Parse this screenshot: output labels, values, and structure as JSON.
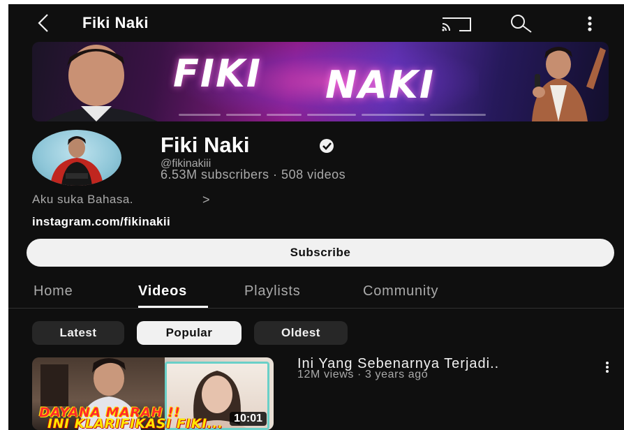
{
  "app_bar": {
    "title": "Fiki Naki",
    "icons": [
      "back-arrow-icon",
      "cast-icon",
      "search-icon",
      "more-vert-icon"
    ]
  },
  "banner": {
    "word_1": "FIKI",
    "word_2": "NAKI"
  },
  "channel": {
    "name": "Fiki Naki",
    "verified": true,
    "handle": "@fikinakiii",
    "stats": "6.53M subscribers · 508 videos",
    "description": "Aku suka Bahasa.",
    "description_more": ">",
    "link": "instagram.com/fikinakii"
  },
  "subscribe": {
    "label": "Subscribe"
  },
  "tabs": [
    {
      "label": "Home",
      "active": false
    },
    {
      "label": "Videos",
      "active": true
    },
    {
      "label": "Playlists",
      "active": false
    },
    {
      "label": "Community",
      "active": false
    }
  ],
  "sort_chips": [
    {
      "label": "Latest",
      "selected": false
    },
    {
      "label": "Popular",
      "selected": true
    },
    {
      "label": "Oldest",
      "selected": false
    }
  ],
  "videos": [
    {
      "title": "Ini Yang Sebenarnya Terjadi..",
      "meta": "12M views · 3 years ago",
      "duration": "10:01",
      "thumb_caption_1": "DAYANA MARAH !!",
      "thumb_caption_2": "INI KLARIFIKASI FIKI..."
    }
  ],
  "colors": {
    "background": "#0f0f0f",
    "text_primary": "#f1f1f1",
    "text_secondary": "#aaaaaa",
    "chip_bg": "#272727",
    "button_light": "#f1f1f1"
  }
}
